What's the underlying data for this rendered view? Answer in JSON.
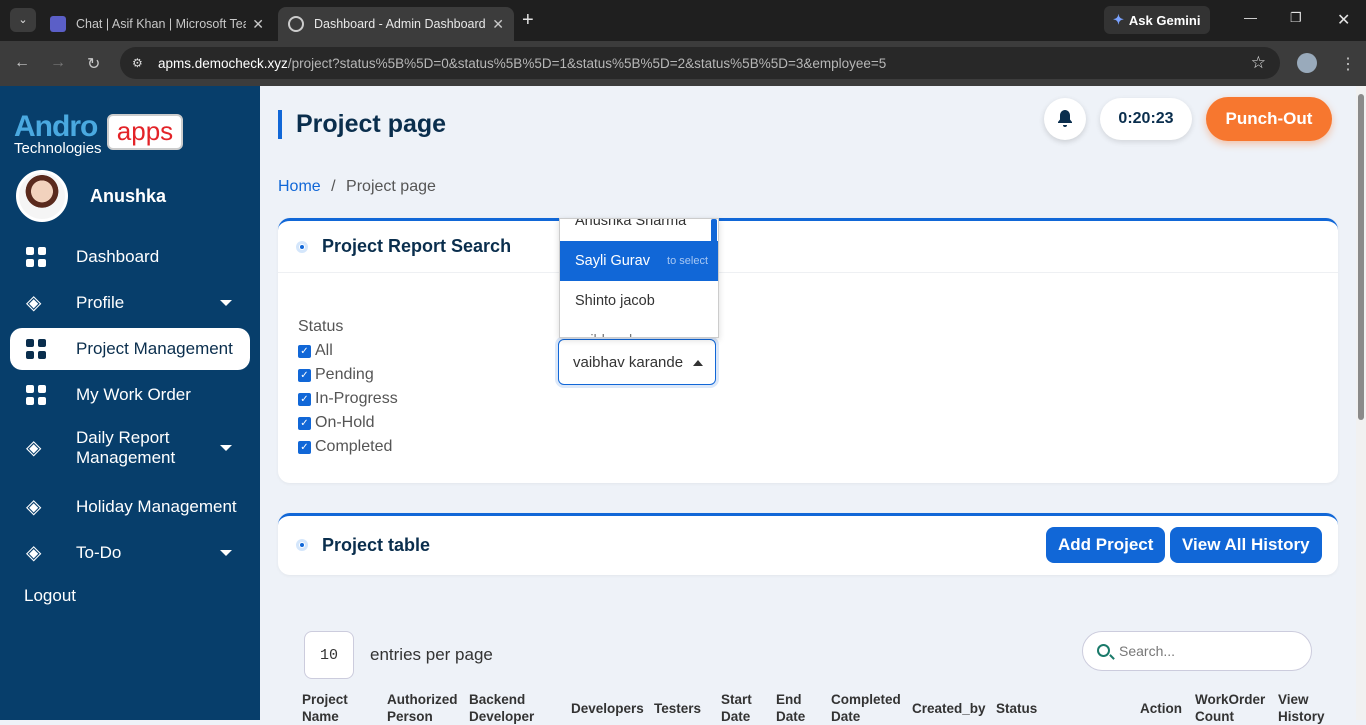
{
  "browser": {
    "tabs": [
      {
        "title": "Chat | Asif Khan | Microsoft Tea",
        "active": false
      },
      {
        "title": "Dashboard - Admin Dashboard",
        "active": true
      }
    ],
    "new_tab": "+",
    "gemini_label": "Ask Gemini",
    "url_host": "apms.democheck.xyz",
    "url_path": "/project?status%5B%5D=0&status%5B%5D=1&status%5B%5D=2&status%5B%5D=3&employee=5"
  },
  "sidebar": {
    "logo_andro": "Andro",
    "logo_apps": "apps",
    "logo_tech": "Technologies",
    "user_name": "Anushka",
    "items": [
      {
        "label": "Dashboard",
        "icon": "grid-icon",
        "caret": false,
        "active": false
      },
      {
        "label": "Profile",
        "icon": "layers-icon",
        "caret": true,
        "active": false
      },
      {
        "label": "Project Management",
        "icon": "grid-icon",
        "caret": false,
        "active": true
      },
      {
        "label": "My Work Order",
        "icon": "grid-icon",
        "caret": false,
        "active": false
      },
      {
        "label": "Daily Report Management",
        "icon": "layers-icon",
        "caret": true,
        "active": false
      },
      {
        "label": "Holiday Management",
        "icon": "layers-icon",
        "caret": false,
        "active": false
      },
      {
        "label": "To-Do",
        "icon": "layers-icon",
        "caret": true,
        "active": false
      }
    ],
    "logout": "Logout"
  },
  "header": {
    "title": "Project page",
    "timer": "0:20:23",
    "punch_label": "Punch-Out"
  },
  "breadcrumb": {
    "home": "Home",
    "separator": "/",
    "current": "Project page"
  },
  "search_card": {
    "title": "Project Report Search",
    "status_label": "Status",
    "statuses": [
      "All",
      "Pending",
      "In-Progress",
      "On-Hold",
      "Completed"
    ],
    "employee_selected": "vaibhav karande",
    "dropdown_options": [
      "Anushka Sharma",
      "Sayli Gurav",
      "Shinto jacob",
      "vaibhav k..."
    ],
    "dropdown_hint": "to select"
  },
  "table_card": {
    "title": "Project table",
    "add_label": "Add Project",
    "history_label": "View All History",
    "entries_value": "10",
    "entries_label": "entries per page",
    "search_placeholder": "Search...",
    "columns": [
      "Project Name",
      "Authorized Person",
      "Backend Developer",
      "Developers",
      "Testers",
      "Start Date",
      "End Date",
      "Completed Date",
      "Created_by",
      "Status",
      "Action",
      "WorkOrder Count",
      "View History"
    ]
  },
  "colors": {
    "primary": "#1167d7",
    "sidebar": "#073e6b",
    "punch": "#f7772f"
  }
}
